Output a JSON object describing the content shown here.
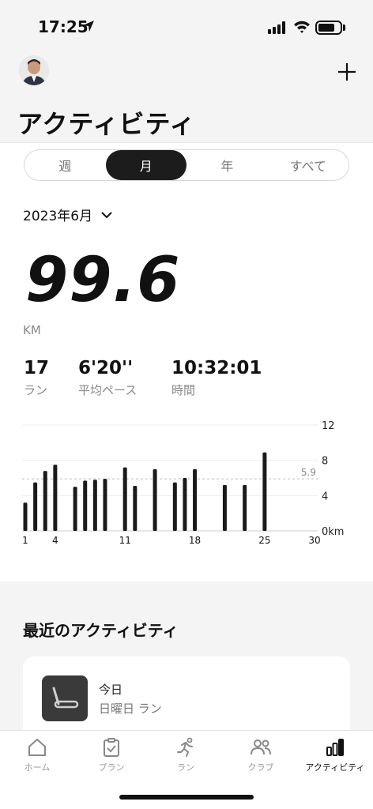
{
  "status_bar": {
    "time": "17:25"
  },
  "header": {
    "title": "アクティビティ"
  },
  "segment": {
    "tabs": [
      "週",
      "月",
      "年",
      "すべて"
    ],
    "selected": "月"
  },
  "period": {
    "label": "2023年6月"
  },
  "summary": {
    "distance": "99.6",
    "unit": "KM",
    "runs": {
      "value": "17",
      "label": "ラン"
    },
    "pace": {
      "value": "6'20''",
      "label": "平均ペース"
    },
    "time": {
      "value": "10:32:01",
      "label": "時間"
    }
  },
  "chart_data": {
    "type": "bar",
    "x": [
      1,
      2,
      3,
      4,
      6,
      7,
      8,
      9,
      11,
      12,
      14,
      16,
      17,
      18,
      21,
      23,
      25
    ],
    "values": [
      3.2,
      5.5,
      6.8,
      7.5,
      5.0,
      5.7,
      5.8,
      5.9,
      7.2,
      5.1,
      7.0,
      5.5,
      6.0,
      7.0,
      5.2,
      5.2,
      8.9
    ],
    "average": 5.9,
    "average_label": "5.9",
    "xlim": [
      1,
      30
    ],
    "ylim": [
      0,
      12
    ],
    "x_ticks": [
      "1",
      "4",
      "11",
      "18",
      "25",
      "30"
    ],
    "y_ticks": [
      "0km",
      "4",
      "8",
      "12"
    ],
    "color": "#1a1a1a"
  },
  "recent": {
    "title": "最近のアクティビティ",
    "card": {
      "title": "今日",
      "subtitle": "日曜日 ラン"
    }
  },
  "tabbar": {
    "items": [
      {
        "label": "ホーム",
        "icon": "home-icon"
      },
      {
        "label": "プラン",
        "icon": "clipboard-icon"
      },
      {
        "label": "ラン",
        "icon": "runner-icon"
      },
      {
        "label": "クラブ",
        "icon": "people-icon"
      },
      {
        "label": "アクティビティ",
        "icon": "bar-chart-icon"
      }
    ],
    "active": "アクティビティ"
  }
}
